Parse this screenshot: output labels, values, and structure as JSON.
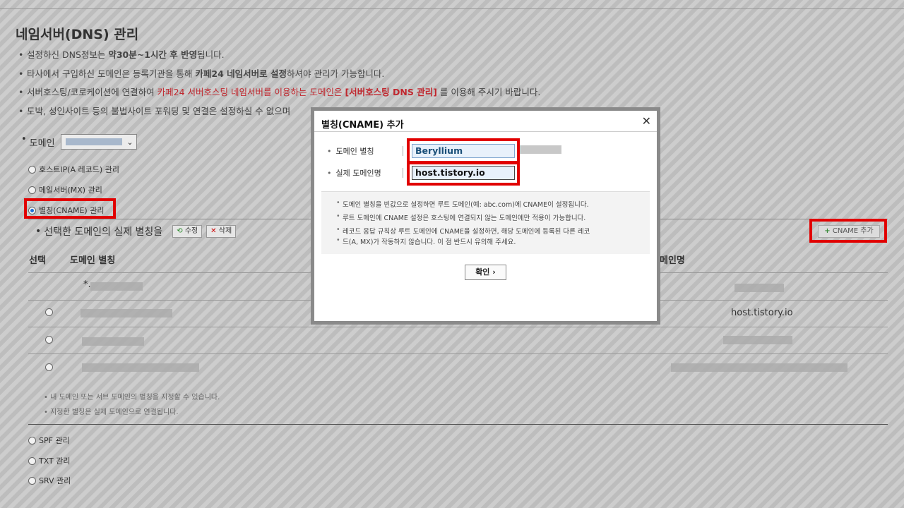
{
  "page": {
    "title": "네임서버(DNS) 관리",
    "notes": [
      {
        "pre": "설정하신 DNS정보는 ",
        "strong": "약30분~1시간 후 반영",
        "post": "됩니다."
      },
      {
        "pre": "타사에서 구입하신 도메인은 등록기관을 통해 ",
        "strong": "카페24 네임서버로 설정",
        "post": "하셔야 관리가 가능합니다."
      },
      {
        "pre": "서버호스팅/코로케이션에 연결하여 ",
        "red": "카페24 서버호스팅 네임서버를 이용하는 도메인은 ",
        "redstrong": "[서버호스팅 DNS 관리]",
        "post": " 를 이용해 주시기 바랍니다."
      },
      {
        "pre": "도박, 성인사이트 등의 불법사이트 포워딩 및 연결은 설정하실 수 없으며"
      }
    ],
    "domain_label": "도메인"
  },
  "options": {
    "a_record": "호스트IP(A 레코드) 관리",
    "mx": "메일서버(MX) 관리",
    "cname": "별칭(CNAME) 관리",
    "spf": "SPF 관리",
    "txt": "TXT 관리",
    "srv": "SRV 관리"
  },
  "section": {
    "title": "선택한 도메인의 실제 별칭을",
    "edit_btn": "수정",
    "delete_btn": "삭제",
    "add_btn": "CNAME 추가"
  },
  "table": {
    "headers": [
      "선택",
      "도메인 별칭",
      "메인명"
    ],
    "rows": [
      {
        "alias_visible": "*.",
        "target": ""
      },
      {
        "alias_visible": "",
        "target": "host.tistory.io"
      },
      {
        "alias_visible": "",
        "target": ""
      },
      {
        "alias_visible": "",
        "target": ""
      }
    ],
    "footnotes": [
      "내 도메인 또는 서브 도메인의 별칭을 지정할 수 있습니다.",
      "지정한 별칭은 실제 도메인으로 연결됩니다."
    ]
  },
  "modal": {
    "title": "별칭(CNAME) 추가",
    "close": "✕",
    "alias_label": "도메인 별칭",
    "alias_value": "Beryllium",
    "target_label": "실제 도메인명",
    "target_value": "host.tistory.io",
    "info": [
      "도메인 별칭을 빈값으로 설정하면 루트 도메인(예: abc.com)에 CNAME이 설정됩니다.",
      "루트 도메인에 CNAME 설정은 호스팅에 연결되지 않는 도메인에만 적용이 가능합니다.",
      "레코드 응답 규칙상 루트 도메인에 CNAME을 설정하면, 해당 도메인에 등록된 다른 레코",
      "드(A, MX)가 작동하지 않습니다. 이 점 반드시 유의해 주세요."
    ],
    "confirm": "확인 ›"
  },
  "colors": {
    "highlight": "#e10000",
    "red_text": "#c0282f",
    "input_bg": "#e8f1fb"
  }
}
